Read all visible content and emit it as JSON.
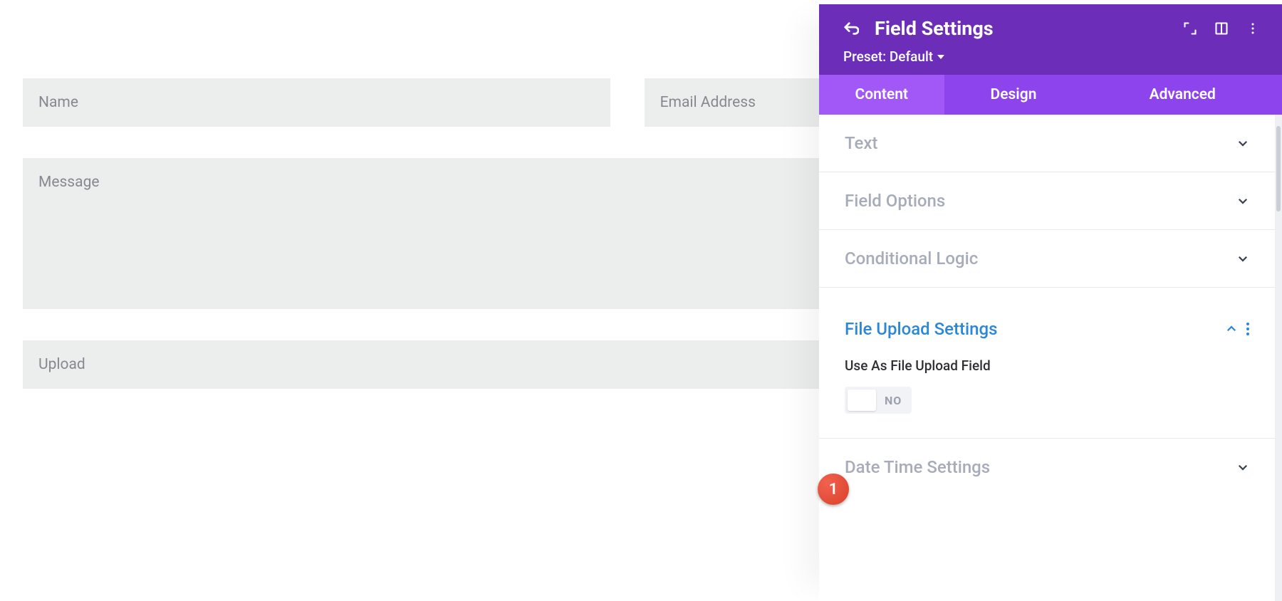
{
  "form": {
    "name_placeholder": "Name",
    "email_placeholder": "Email Address",
    "message_placeholder": "Message",
    "upload_placeholder": "Upload"
  },
  "panel": {
    "title": "Field Settings",
    "preset_label": "Preset: Default",
    "tabs": {
      "content": "Content",
      "design": "Design",
      "advanced": "Advanced"
    },
    "sections": {
      "text": "Text",
      "field_options": "Field Options",
      "conditional_logic": "Conditional Logic",
      "file_upload_settings": "File Upload Settings",
      "date_time_settings": "Date Time Settings"
    },
    "file_upload": {
      "option_label": "Use As File Upload Field",
      "toggle_value": "NO"
    }
  },
  "annotation": {
    "badge_1": "1"
  }
}
